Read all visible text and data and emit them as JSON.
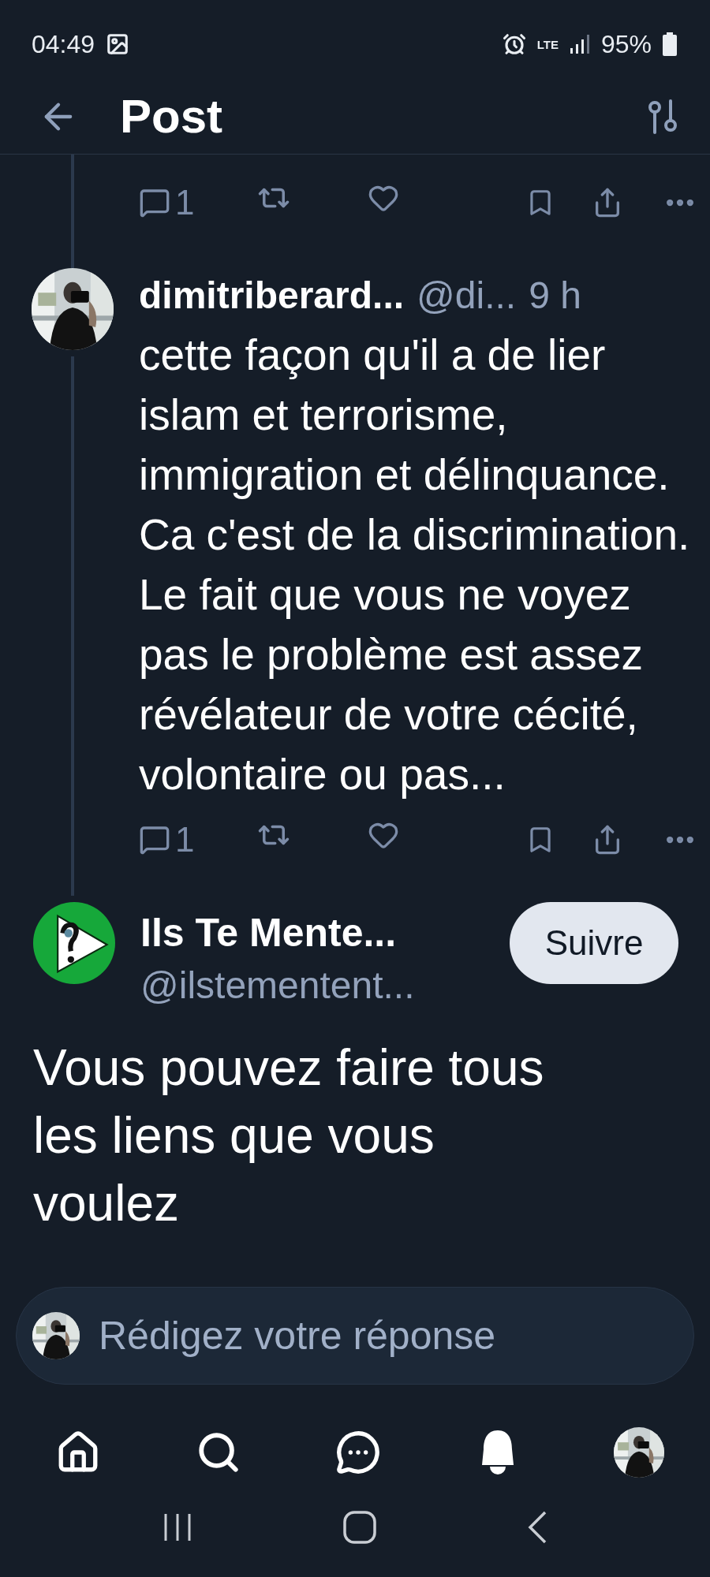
{
  "status_bar": {
    "time": "04:49",
    "network": "LTE",
    "battery": "95%"
  },
  "header": {
    "title": "Post"
  },
  "thread_fragment": {
    "reply_count": "1"
  },
  "reply": {
    "name": "dimitriberard...",
    "handle": "@di...",
    "time": "9 h",
    "text": "cette façon qu'il a de lier islam et terrorisme, immigration et délinquance. Ca c'est de la discrimination. Le fait que vous ne voyez pas le problème est assez révélateur de votre cécité, volontaire ou pas...",
    "reply_count": "1"
  },
  "main_post": {
    "name": "Ils Te Mente...",
    "handle": "@ilstementent...",
    "follow_button": "Suivre",
    "text": "Vous pouvez faire tous les liens que vous voulez"
  },
  "composer": {
    "placeholder": "Rédigez votre réponse"
  }
}
